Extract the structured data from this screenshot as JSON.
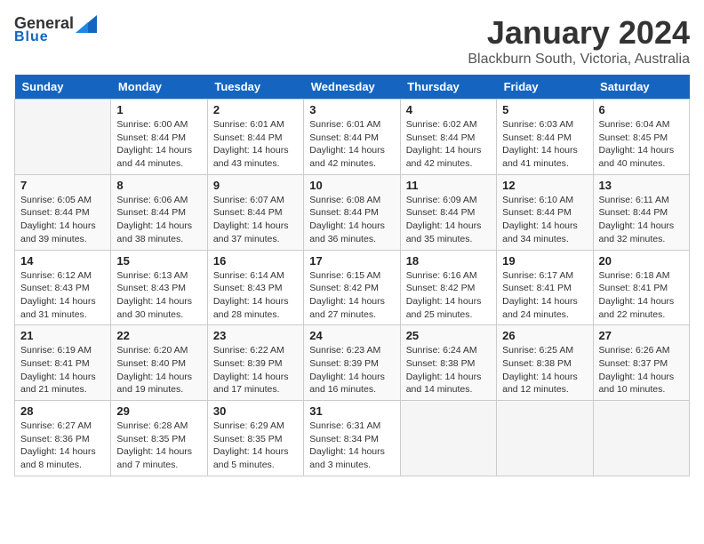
{
  "header": {
    "logo_general": "General",
    "logo_blue": "Blue",
    "month_title": "January 2024",
    "location": "Blackburn South, Victoria, Australia"
  },
  "days_of_week": [
    "Sunday",
    "Monday",
    "Tuesday",
    "Wednesday",
    "Thursday",
    "Friday",
    "Saturday"
  ],
  "weeks": [
    [
      {
        "day": "",
        "sunrise": "",
        "sunset": "",
        "daylight": ""
      },
      {
        "day": "1",
        "sunrise": "Sunrise: 6:00 AM",
        "sunset": "Sunset: 8:44 PM",
        "daylight": "Daylight: 14 hours and 44 minutes."
      },
      {
        "day": "2",
        "sunrise": "Sunrise: 6:01 AM",
        "sunset": "Sunset: 8:44 PM",
        "daylight": "Daylight: 14 hours and 43 minutes."
      },
      {
        "day": "3",
        "sunrise": "Sunrise: 6:01 AM",
        "sunset": "Sunset: 8:44 PM",
        "daylight": "Daylight: 14 hours and 42 minutes."
      },
      {
        "day": "4",
        "sunrise": "Sunrise: 6:02 AM",
        "sunset": "Sunset: 8:44 PM",
        "daylight": "Daylight: 14 hours and 42 minutes."
      },
      {
        "day": "5",
        "sunrise": "Sunrise: 6:03 AM",
        "sunset": "Sunset: 8:44 PM",
        "daylight": "Daylight: 14 hours and 41 minutes."
      },
      {
        "day": "6",
        "sunrise": "Sunrise: 6:04 AM",
        "sunset": "Sunset: 8:45 PM",
        "daylight": "Daylight: 14 hours and 40 minutes."
      }
    ],
    [
      {
        "day": "7",
        "sunrise": "Sunrise: 6:05 AM",
        "sunset": "Sunset: 8:44 PM",
        "daylight": "Daylight: 14 hours and 39 minutes."
      },
      {
        "day": "8",
        "sunrise": "Sunrise: 6:06 AM",
        "sunset": "Sunset: 8:44 PM",
        "daylight": "Daylight: 14 hours and 38 minutes."
      },
      {
        "day": "9",
        "sunrise": "Sunrise: 6:07 AM",
        "sunset": "Sunset: 8:44 PM",
        "daylight": "Daylight: 14 hours and 37 minutes."
      },
      {
        "day": "10",
        "sunrise": "Sunrise: 6:08 AM",
        "sunset": "Sunset: 8:44 PM",
        "daylight": "Daylight: 14 hours and 36 minutes."
      },
      {
        "day": "11",
        "sunrise": "Sunrise: 6:09 AM",
        "sunset": "Sunset: 8:44 PM",
        "daylight": "Daylight: 14 hours and 35 minutes."
      },
      {
        "day": "12",
        "sunrise": "Sunrise: 6:10 AM",
        "sunset": "Sunset: 8:44 PM",
        "daylight": "Daylight: 14 hours and 34 minutes."
      },
      {
        "day": "13",
        "sunrise": "Sunrise: 6:11 AM",
        "sunset": "Sunset: 8:44 PM",
        "daylight": "Daylight: 14 hours and 32 minutes."
      }
    ],
    [
      {
        "day": "14",
        "sunrise": "Sunrise: 6:12 AM",
        "sunset": "Sunset: 8:43 PM",
        "daylight": "Daylight: 14 hours and 31 minutes."
      },
      {
        "day": "15",
        "sunrise": "Sunrise: 6:13 AM",
        "sunset": "Sunset: 8:43 PM",
        "daylight": "Daylight: 14 hours and 30 minutes."
      },
      {
        "day": "16",
        "sunrise": "Sunrise: 6:14 AM",
        "sunset": "Sunset: 8:43 PM",
        "daylight": "Daylight: 14 hours and 28 minutes."
      },
      {
        "day": "17",
        "sunrise": "Sunrise: 6:15 AM",
        "sunset": "Sunset: 8:42 PM",
        "daylight": "Daylight: 14 hours and 27 minutes."
      },
      {
        "day": "18",
        "sunrise": "Sunrise: 6:16 AM",
        "sunset": "Sunset: 8:42 PM",
        "daylight": "Daylight: 14 hours and 25 minutes."
      },
      {
        "day": "19",
        "sunrise": "Sunrise: 6:17 AM",
        "sunset": "Sunset: 8:41 PM",
        "daylight": "Daylight: 14 hours and 24 minutes."
      },
      {
        "day": "20",
        "sunrise": "Sunrise: 6:18 AM",
        "sunset": "Sunset: 8:41 PM",
        "daylight": "Daylight: 14 hours and 22 minutes."
      }
    ],
    [
      {
        "day": "21",
        "sunrise": "Sunrise: 6:19 AM",
        "sunset": "Sunset: 8:41 PM",
        "daylight": "Daylight: 14 hours and 21 minutes."
      },
      {
        "day": "22",
        "sunrise": "Sunrise: 6:20 AM",
        "sunset": "Sunset: 8:40 PM",
        "daylight": "Daylight: 14 hours and 19 minutes."
      },
      {
        "day": "23",
        "sunrise": "Sunrise: 6:22 AM",
        "sunset": "Sunset: 8:39 PM",
        "daylight": "Daylight: 14 hours and 17 minutes."
      },
      {
        "day": "24",
        "sunrise": "Sunrise: 6:23 AM",
        "sunset": "Sunset: 8:39 PM",
        "daylight": "Daylight: 14 hours and 16 minutes."
      },
      {
        "day": "25",
        "sunrise": "Sunrise: 6:24 AM",
        "sunset": "Sunset: 8:38 PM",
        "daylight": "Daylight: 14 hours and 14 minutes."
      },
      {
        "day": "26",
        "sunrise": "Sunrise: 6:25 AM",
        "sunset": "Sunset: 8:38 PM",
        "daylight": "Daylight: 14 hours and 12 minutes."
      },
      {
        "day": "27",
        "sunrise": "Sunrise: 6:26 AM",
        "sunset": "Sunset: 8:37 PM",
        "daylight": "Daylight: 14 hours and 10 minutes."
      }
    ],
    [
      {
        "day": "28",
        "sunrise": "Sunrise: 6:27 AM",
        "sunset": "Sunset: 8:36 PM",
        "daylight": "Daylight: 14 hours and 8 minutes."
      },
      {
        "day": "29",
        "sunrise": "Sunrise: 6:28 AM",
        "sunset": "Sunset: 8:35 PM",
        "daylight": "Daylight: 14 hours and 7 minutes."
      },
      {
        "day": "30",
        "sunrise": "Sunrise: 6:29 AM",
        "sunset": "Sunset: 8:35 PM",
        "daylight": "Daylight: 14 hours and 5 minutes."
      },
      {
        "day": "31",
        "sunrise": "Sunrise: 6:31 AM",
        "sunset": "Sunset: 8:34 PM",
        "daylight": "Daylight: 14 hours and 3 minutes."
      },
      {
        "day": "",
        "sunrise": "",
        "sunset": "",
        "daylight": ""
      },
      {
        "day": "",
        "sunrise": "",
        "sunset": "",
        "daylight": ""
      },
      {
        "day": "",
        "sunrise": "",
        "sunset": "",
        "daylight": ""
      }
    ]
  ]
}
